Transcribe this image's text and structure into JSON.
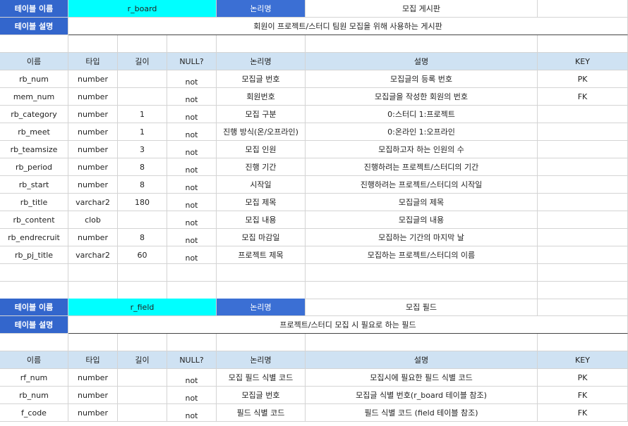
{
  "table1": {
    "name_label": "테이블 이름",
    "name_value": "r_board",
    "logical_label": "논리명",
    "logical_value": "모집 게시판",
    "desc_label": "테이블 설명",
    "desc_value": "회원이 프로젝트/스터디 팀원 모집을 위해 사용하는 게시판",
    "columns": [
      "이름",
      "타입",
      "길이",
      "NULL?",
      "논리명",
      "설명",
      "KEY"
    ],
    "rows": [
      [
        "rb_num",
        "number",
        "",
        "not",
        "모집글 번호",
        "모집글의 등록 번호",
        "PK"
      ],
      [
        "mem_num",
        "number",
        "",
        "not",
        "회원번호",
        "모집글을 작성한 회원의 번호",
        "FK"
      ],
      [
        "rb_category",
        "number",
        "1",
        "not",
        "모집 구분",
        "0:스터디 1:프로젝트",
        ""
      ],
      [
        "rb_meet",
        "number",
        "1",
        "not",
        "진행 방식(온/오프라인)",
        "0:온라인 1:오프라인",
        ""
      ],
      [
        "rb_teamsize",
        "number",
        "3",
        "not",
        "모집 인원",
        "모집하고자 하는 인원의 수",
        ""
      ],
      [
        "rb_period",
        "number",
        "8",
        "not",
        "진행 기간",
        "진행하려는 프로젝트/스터디의 기간",
        ""
      ],
      [
        "rb_start",
        "number",
        "8",
        "not",
        "시작일",
        "진행하려는 프로젝트/스터디의 시작일",
        ""
      ],
      [
        "rb_title",
        "varchar2",
        "180",
        "not",
        "모집 제목",
        "모집글의 제목",
        ""
      ],
      [
        "rb_content",
        "clob",
        "",
        "not",
        "모집 내용",
        "모집글의 내용",
        ""
      ],
      [
        "rb_endrecruit",
        "number",
        "8",
        "not",
        "모집 마감일",
        "모집하는 기간의 마지막 날",
        ""
      ],
      [
        "rb_pj_title",
        "varchar2",
        "60",
        "not",
        "프로젝트 제목",
        "모집하는 프로젝트/스터디의 이름",
        ""
      ]
    ]
  },
  "table2": {
    "name_label": "테이블 이름",
    "name_value": "r_field",
    "logical_label": "논리명",
    "logical_value": "모집 필드",
    "desc_label": "테이블 설명",
    "desc_value": "프로젝트/스터디 모집 시 필요로 하는 필드",
    "columns": [
      "이름",
      "타입",
      "길이",
      "NULL?",
      "논리명",
      "설명",
      "KEY"
    ],
    "rows": [
      [
        "rf_num",
        "number",
        "",
        "not",
        "모집 필드 식별 코드",
        "모집시에 필요한 필드 식별 코드",
        "PK"
      ],
      [
        "rb_num",
        "number",
        "",
        "not",
        "모집글 번호",
        "모집글 식별 번호(r_board 테이블 참조)",
        "FK"
      ],
      [
        "f_code",
        "number",
        "",
        "not",
        "필드 식별 코드",
        "필드 식별 코드 (field 테이블 참조)",
        "FK"
      ]
    ]
  },
  "colors": {
    "label_bg": "#3366cc",
    "cyan": "#00ffff",
    "header_bg": "#cfe2f3"
  }
}
